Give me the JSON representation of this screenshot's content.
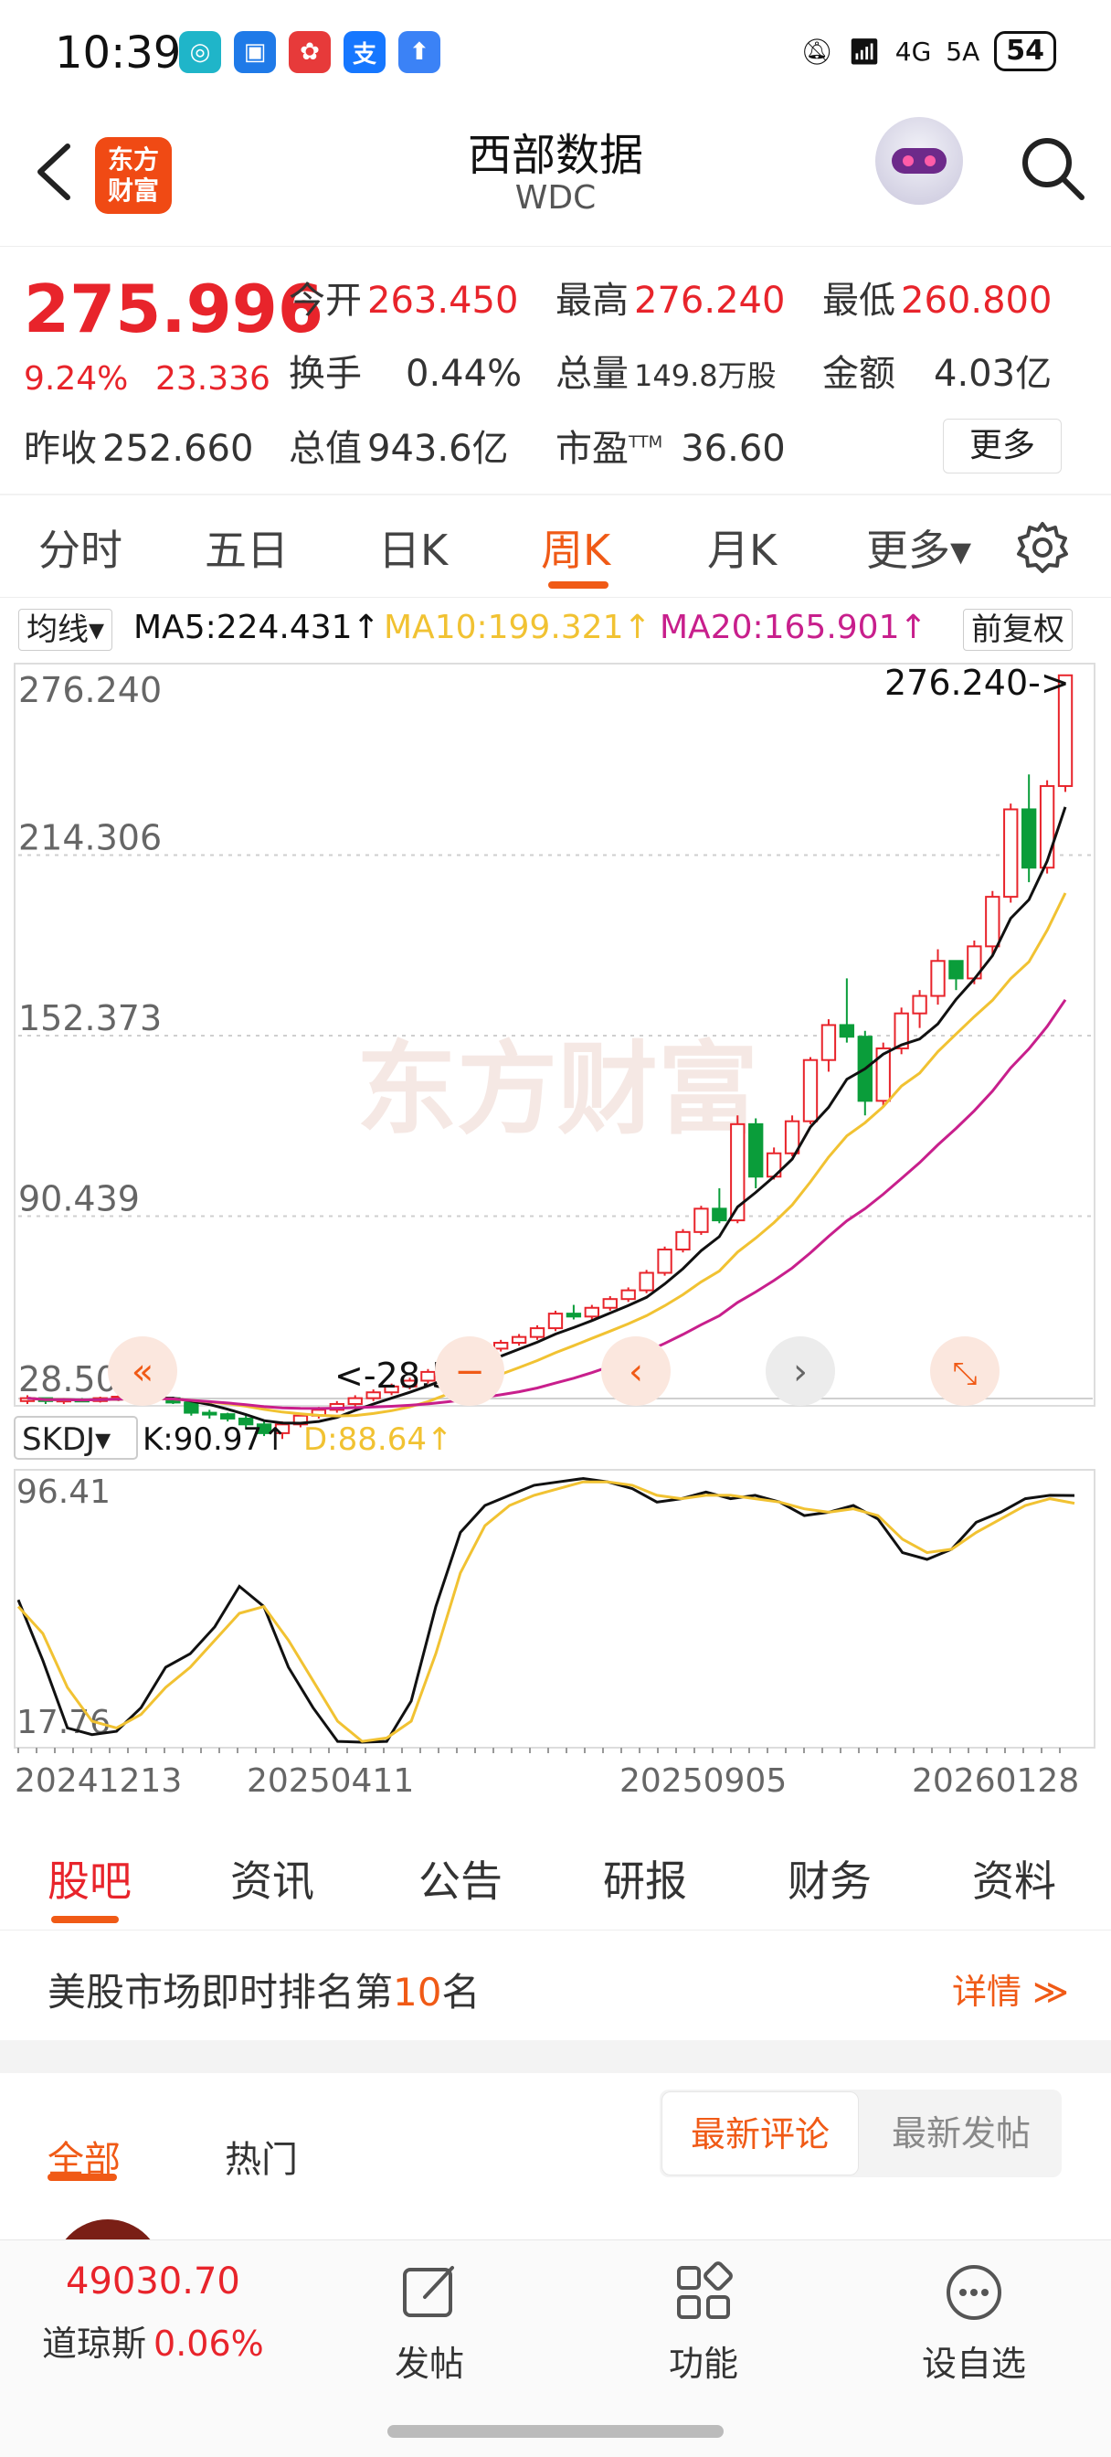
{
  "status": {
    "time": "10:39",
    "battery": "54",
    "network": "4G",
    "network2": "5A"
  },
  "header": {
    "logo_text": "东方\n财富",
    "title": "西部数据",
    "ticker": "WDC"
  },
  "quote": {
    "price": "275.996",
    "change_pct": "9.24%",
    "change_amt": "23.336",
    "open_label": "今开",
    "open": "263.450",
    "high_label": "最高",
    "high": "276.240",
    "low_label": "最低",
    "low": "260.800",
    "turnover_label": "换手",
    "turnover": "0.44%",
    "volume_label": "总量",
    "volume": "149.8万股",
    "amount_label": "金额",
    "amount": "4.03亿",
    "prev_close_label": "昨收",
    "prev_close": "252.660",
    "mktcap_label": "总值",
    "mktcap": "943.6亿",
    "pe_label": "市盈",
    "pe_sup": "TTM",
    "pe": "36.60",
    "more_label": "更多"
  },
  "period_tabs": [
    "分时",
    "五日",
    "日K",
    "周K",
    "月K",
    "更多▾"
  ],
  "active_period": "周K",
  "ma": {
    "selector": "均线▾",
    "ma5": "MA5:224.431↑",
    "ma10": "MA10:199.321↑",
    "ma20": "MA20:165.901↑",
    "adjust": "前复权",
    "colors": {
      "ma5": "#111111",
      "ma10": "#f1c232",
      "ma20": "#c81f8c"
    }
  },
  "kline": {
    "y_labels": [
      "276.240",
      "214.306",
      "152.373",
      "90.439",
      "28.505"
    ],
    "max_label": "276.240->",
    "min_label": "<-28.505",
    "watermark": "东方财富"
  },
  "indicator": {
    "selector": "SKDJ▾",
    "k": "K:90.97↑",
    "d": "D:88.64↑",
    "y_max": "96.41",
    "y_min": "17.76"
  },
  "x_labels": [
    "20241213",
    "20250411",
    "20250905",
    "20260128"
  ],
  "chart_data": {
    "type": "line",
    "title": "",
    "price_range": [
      28.505,
      276.24
    ],
    "candles_weekly": [
      [
        27,
        29,
        26,
        28
      ],
      [
        28,
        28,
        26,
        27
      ],
      [
        27,
        28,
        26,
        27.5
      ],
      [
        27.5,
        28,
        27,
        27
      ],
      [
        27,
        28.5,
        26.5,
        28
      ],
      [
        28,
        29,
        27,
        28.5
      ],
      [
        28.5,
        30,
        27.5,
        29
      ],
      [
        29,
        29.5,
        27.5,
        28
      ],
      [
        28,
        28.5,
        26,
        26.5
      ],
      [
        26.5,
        27,
        22,
        23
      ],
      [
        23,
        24,
        21,
        22.5
      ],
      [
        22.5,
        23,
        20,
        21
      ],
      [
        21,
        22,
        18,
        19
      ],
      [
        19,
        20,
        15,
        16
      ],
      [
        16,
        20,
        14,
        19
      ],
      [
        19,
        23,
        18,
        22
      ],
      [
        22,
        25,
        21,
        24
      ],
      [
        24,
        27,
        23,
        26
      ],
      [
        26,
        29,
        25,
        28
      ],
      [
        28,
        31,
        27,
        30
      ],
      [
        30,
        33,
        29,
        32
      ],
      [
        32,
        35,
        31,
        34
      ],
      [
        34,
        38,
        33,
        37
      ],
      [
        37,
        41,
        36,
        40
      ],
      [
        40,
        44,
        39,
        43
      ],
      [
        43,
        46,
        42,
        45
      ],
      [
        45,
        48,
        44,
        47
      ],
      [
        47,
        50,
        46,
        49
      ],
      [
        49,
        53,
        48,
        52
      ],
      [
        52,
        58,
        51,
        57
      ],
      [
        57,
        60,
        55,
        56
      ],
      [
        56,
        60,
        55,
        59
      ],
      [
        59,
        63,
        58,
        62
      ],
      [
        62,
        66,
        61,
        65
      ],
      [
        65,
        72,
        64,
        71
      ],
      [
        71,
        80,
        70,
        79
      ],
      [
        79,
        86,
        78,
        85
      ],
      [
        85,
        94,
        84,
        93
      ],
      [
        93,
        100,
        88,
        89
      ],
      [
        89,
        125,
        88,
        122
      ],
      [
        122,
        124,
        100,
        104
      ],
      [
        104,
        114,
        103,
        112
      ],
      [
        112,
        125,
        111,
        123
      ],
      [
        123,
        145,
        122,
        144
      ],
      [
        144,
        158,
        140,
        156
      ],
      [
        156,
        172,
        150,
        152
      ],
      [
        152,
        154,
        125,
        130
      ],
      [
        130,
        150,
        128,
        148
      ],
      [
        148,
        162,
        146,
        160
      ],
      [
        160,
        168,
        155,
        166
      ],
      [
        166,
        182,
        163,
        178
      ],
      [
        178,
        178,
        168,
        172
      ],
      [
        172,
        185,
        170,
        183
      ],
      [
        183,
        202,
        180,
        200
      ],
      [
        200,
        232,
        198,
        230
      ],
      [
        230,
        242,
        205,
        210
      ],
      [
        210,
        240,
        208,
        238
      ],
      [
        238,
        276.24,
        236,
        275.996
      ]
    ],
    "series": [
      {
        "name": "MA5",
        "values": "224.431 (latest)"
      },
      {
        "name": "MA10",
        "values": "199.321 (latest)"
      },
      {
        "name": "MA20",
        "values": "165.901 (latest)"
      }
    ],
    "skdj": {
      "k": [
        60,
        42,
        22,
        20,
        21,
        28,
        40,
        44,
        52,
        64,
        58,
        40,
        28,
        18,
        17,
        18,
        30,
        58,
        80,
        88,
        91,
        94,
        95,
        96,
        95,
        93,
        89,
        90,
        92,
        90,
        91,
        89,
        85,
        86,
        88,
        84,
        74,
        72,
        75,
        83,
        86,
        90,
        91,
        90.97
      ],
      "d": [
        58,
        50,
        34,
        24,
        22,
        26,
        34,
        40,
        48,
        56,
        58,
        48,
        36,
        24,
        18,
        19,
        24,
        44,
        68,
        82,
        88,
        91,
        93,
        95,
        95,
        94,
        91,
        90,
        91,
        91,
        90,
        89,
        87,
        86,
        87,
        85,
        78,
        74,
        75,
        80,
        84,
        88,
        90,
        88.64
      ],
      "range": [
        17.76,
        96.41
      ]
    },
    "xlabel": "",
    "ylabel": ""
  },
  "bottom_tabs": [
    "股吧",
    "资讯",
    "公告",
    "研报",
    "财务",
    "资料"
  ],
  "active_bottom_tab": "股吧",
  "rank": {
    "prefix": "美股市场即时排名第",
    "num": "10",
    "suffix": "名",
    "detail": "详情 ≫"
  },
  "feed": {
    "tabs": [
      "全部",
      "热门"
    ],
    "active_tab": "全部",
    "sort_a": "最新评论",
    "sort_b": "最新发帖",
    "peek_text": "..."
  },
  "bottombar": {
    "index_value": "49030.70",
    "index_name": "道琼斯",
    "index_pct": "0.06%",
    "post": "发帖",
    "function": "功能",
    "watchlist": "设自选"
  }
}
